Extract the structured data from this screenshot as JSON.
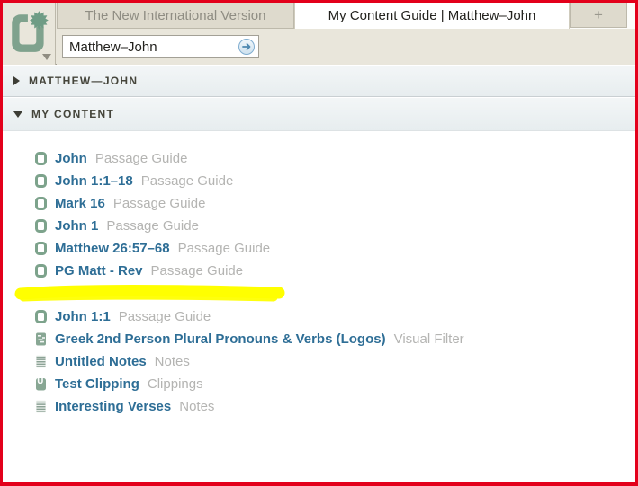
{
  "colors": {
    "border_red": "#e3001b",
    "chrome_beige": "#e9e6db",
    "link_blue": "#2e6e96",
    "type_label_gray": "#b4b4b2",
    "icon_green": "#7da38c",
    "highlight_yellow": "#ffff00"
  },
  "tabs": {
    "items": [
      {
        "label": "The New International Version",
        "active": false
      },
      {
        "label": "My Content Guide | Matthew–John",
        "active": true
      }
    ],
    "new_tab_label": "+"
  },
  "toolbar": {
    "reference_value": "Matthew–John",
    "go_icon": "arrow-right-icon"
  },
  "sections": [
    {
      "label": "MATTHEW—JOHN",
      "expanded": false
    },
    {
      "label": "MY CONTENT",
      "expanded": true
    }
  ],
  "content": {
    "groups": [
      {
        "items": [
          {
            "title": "John",
            "type": "Passage Guide",
            "icon": "passage-guide-icon"
          },
          {
            "title": "John 1:1–18",
            "type": "Passage Guide",
            "icon": "passage-guide-icon"
          },
          {
            "title": "Mark 16",
            "type": "Passage Guide",
            "icon": "passage-guide-icon"
          },
          {
            "title": "John 1",
            "type": "Passage Guide",
            "icon": "passage-guide-icon"
          },
          {
            "title": "Matthew 26:57–68",
            "type": "Passage Guide",
            "icon": "passage-guide-icon"
          },
          {
            "title": "PG Matt - Rev",
            "type": "Passage Guide",
            "icon": "passage-guide-icon"
          }
        ]
      },
      {
        "items": [
          {
            "title": "John 1:1",
            "type": "Passage Guide",
            "icon": "passage-guide-icon"
          },
          {
            "title": "Greek 2nd Person Plural Pronouns & Verbs (Logos)",
            "type": "Visual Filter",
            "icon": "visual-filter-icon"
          },
          {
            "title": "Untitled Notes",
            "type": "Notes",
            "icon": "notes-icon"
          },
          {
            "title": "Test Clipping",
            "type": "Clippings",
            "icon": "clippings-icon"
          },
          {
            "title": "Interesting Verses",
            "type": "Notes",
            "icon": "notes-icon"
          }
        ]
      }
    ],
    "annotation": {
      "kind": "highlighter-stroke",
      "color": "#ffff00"
    }
  }
}
